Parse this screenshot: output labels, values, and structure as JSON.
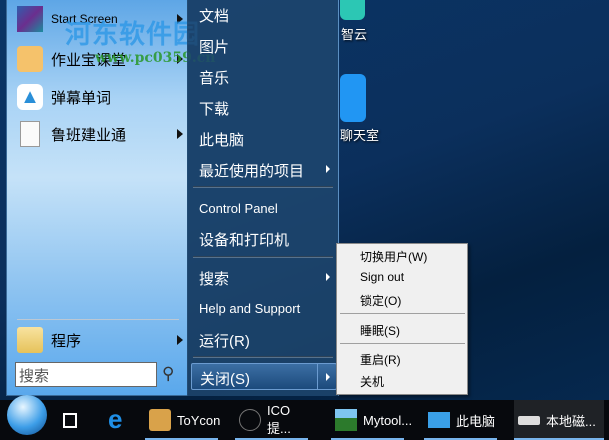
{
  "desktop": {
    "icons": [
      {
        "label": "智云",
        "color": "#2cc7b4"
      },
      {
        "label": "聊天室",
        "color": "#2196f3"
      }
    ]
  },
  "watermark": {
    "title": "河东软件园",
    "url": "www.pc0359.cn"
  },
  "left_pane": {
    "items": [
      {
        "label": "Start Screen",
        "has_submenu": true
      },
      {
        "label": "作业宝课堂",
        "has_submenu": true
      },
      {
        "label": "弹幕单词",
        "has_submenu": false
      },
      {
        "label": "鲁班建业通",
        "has_submenu": true
      }
    ],
    "programs": "程序",
    "search_placeholder": "搜索"
  },
  "right_pane": {
    "items": [
      "文档",
      "图片",
      "音乐",
      "下载",
      "此电脑",
      "最近使用的项目",
      "Control Panel",
      "设备和打印机",
      "搜索",
      "Help and Support",
      "运行(R)"
    ],
    "shutdown": "关闭(S)"
  },
  "power_menu": {
    "items": [
      "切换用户(W)",
      "Sign out",
      "锁定(O)",
      "睡眠(S)",
      "重启(R)",
      "关机"
    ]
  },
  "taskbar": {
    "items": [
      "ToYcon",
      "ICO提...",
      "Mytool...",
      "此电脑",
      "本地磁..."
    ]
  }
}
